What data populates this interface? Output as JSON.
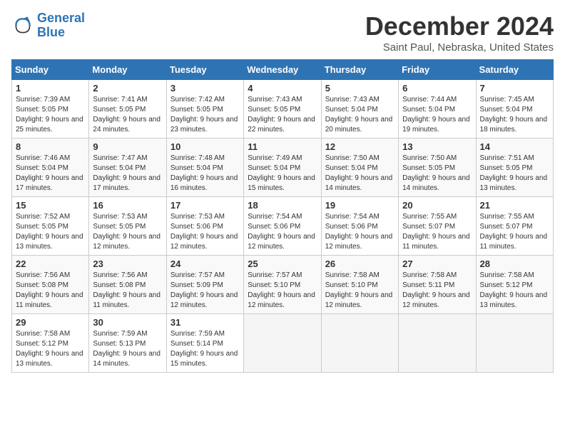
{
  "logo": {
    "line1": "General",
    "line2": "Blue"
  },
  "title": "December 2024",
  "location": "Saint Paul, Nebraska, United States",
  "days_of_week": [
    "Sunday",
    "Monday",
    "Tuesday",
    "Wednesday",
    "Thursday",
    "Friday",
    "Saturday"
  ],
  "weeks": [
    [
      {
        "day": "1",
        "sunrise": "7:39 AM",
        "sunset": "5:05 PM",
        "daylight": "9 hours and 25 minutes."
      },
      {
        "day": "2",
        "sunrise": "7:41 AM",
        "sunset": "5:05 PM",
        "daylight": "9 hours and 24 minutes."
      },
      {
        "day": "3",
        "sunrise": "7:42 AM",
        "sunset": "5:05 PM",
        "daylight": "9 hours and 23 minutes."
      },
      {
        "day": "4",
        "sunrise": "7:43 AM",
        "sunset": "5:05 PM",
        "daylight": "9 hours and 22 minutes."
      },
      {
        "day": "5",
        "sunrise": "7:43 AM",
        "sunset": "5:04 PM",
        "daylight": "9 hours and 20 minutes."
      },
      {
        "day": "6",
        "sunrise": "7:44 AM",
        "sunset": "5:04 PM",
        "daylight": "9 hours and 19 minutes."
      },
      {
        "day": "7",
        "sunrise": "7:45 AM",
        "sunset": "5:04 PM",
        "daylight": "9 hours and 18 minutes."
      }
    ],
    [
      {
        "day": "8",
        "sunrise": "7:46 AM",
        "sunset": "5:04 PM",
        "daylight": "9 hours and 17 minutes."
      },
      {
        "day": "9",
        "sunrise": "7:47 AM",
        "sunset": "5:04 PM",
        "daylight": "9 hours and 17 minutes."
      },
      {
        "day": "10",
        "sunrise": "7:48 AM",
        "sunset": "5:04 PM",
        "daylight": "9 hours and 16 minutes."
      },
      {
        "day": "11",
        "sunrise": "7:49 AM",
        "sunset": "5:04 PM",
        "daylight": "9 hours and 15 minutes."
      },
      {
        "day": "12",
        "sunrise": "7:50 AM",
        "sunset": "5:04 PM",
        "daylight": "9 hours and 14 minutes."
      },
      {
        "day": "13",
        "sunrise": "7:50 AM",
        "sunset": "5:05 PM",
        "daylight": "9 hours and 14 minutes."
      },
      {
        "day": "14",
        "sunrise": "7:51 AM",
        "sunset": "5:05 PM",
        "daylight": "9 hours and 13 minutes."
      }
    ],
    [
      {
        "day": "15",
        "sunrise": "7:52 AM",
        "sunset": "5:05 PM",
        "daylight": "9 hours and 13 minutes."
      },
      {
        "day": "16",
        "sunrise": "7:53 AM",
        "sunset": "5:05 PM",
        "daylight": "9 hours and 12 minutes."
      },
      {
        "day": "17",
        "sunrise": "7:53 AM",
        "sunset": "5:06 PM",
        "daylight": "9 hours and 12 minutes."
      },
      {
        "day": "18",
        "sunrise": "7:54 AM",
        "sunset": "5:06 PM",
        "daylight": "9 hours and 12 minutes."
      },
      {
        "day": "19",
        "sunrise": "7:54 AM",
        "sunset": "5:06 PM",
        "daylight": "9 hours and 12 minutes."
      },
      {
        "day": "20",
        "sunrise": "7:55 AM",
        "sunset": "5:07 PM",
        "daylight": "9 hours and 11 minutes."
      },
      {
        "day": "21",
        "sunrise": "7:55 AM",
        "sunset": "5:07 PM",
        "daylight": "9 hours and 11 minutes."
      }
    ],
    [
      {
        "day": "22",
        "sunrise": "7:56 AM",
        "sunset": "5:08 PM",
        "daylight": "9 hours and 11 minutes."
      },
      {
        "day": "23",
        "sunrise": "7:56 AM",
        "sunset": "5:08 PM",
        "daylight": "9 hours and 11 minutes."
      },
      {
        "day": "24",
        "sunrise": "7:57 AM",
        "sunset": "5:09 PM",
        "daylight": "9 hours and 12 minutes."
      },
      {
        "day": "25",
        "sunrise": "7:57 AM",
        "sunset": "5:10 PM",
        "daylight": "9 hours and 12 minutes."
      },
      {
        "day": "26",
        "sunrise": "7:58 AM",
        "sunset": "5:10 PM",
        "daylight": "9 hours and 12 minutes."
      },
      {
        "day": "27",
        "sunrise": "7:58 AM",
        "sunset": "5:11 PM",
        "daylight": "9 hours and 12 minutes."
      },
      {
        "day": "28",
        "sunrise": "7:58 AM",
        "sunset": "5:12 PM",
        "daylight": "9 hours and 13 minutes."
      }
    ],
    [
      {
        "day": "29",
        "sunrise": "7:58 AM",
        "sunset": "5:12 PM",
        "daylight": "9 hours and 13 minutes."
      },
      {
        "day": "30",
        "sunrise": "7:59 AM",
        "sunset": "5:13 PM",
        "daylight": "9 hours and 14 minutes."
      },
      {
        "day": "31",
        "sunrise": "7:59 AM",
        "sunset": "5:14 PM",
        "daylight": "9 hours and 15 minutes."
      },
      null,
      null,
      null,
      null
    ]
  ]
}
